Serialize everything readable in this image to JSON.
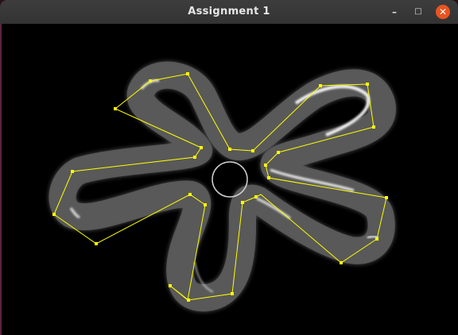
{
  "window": {
    "title": "Assignment 1",
    "controls": {
      "minimize": "–",
      "maximize": "□",
      "close": "✕"
    }
  },
  "colors": {
    "titlebar": "#363636",
    "canvas": "#000000",
    "control_polygon": "#ffff00",
    "close_button": "#e95420"
  }
}
